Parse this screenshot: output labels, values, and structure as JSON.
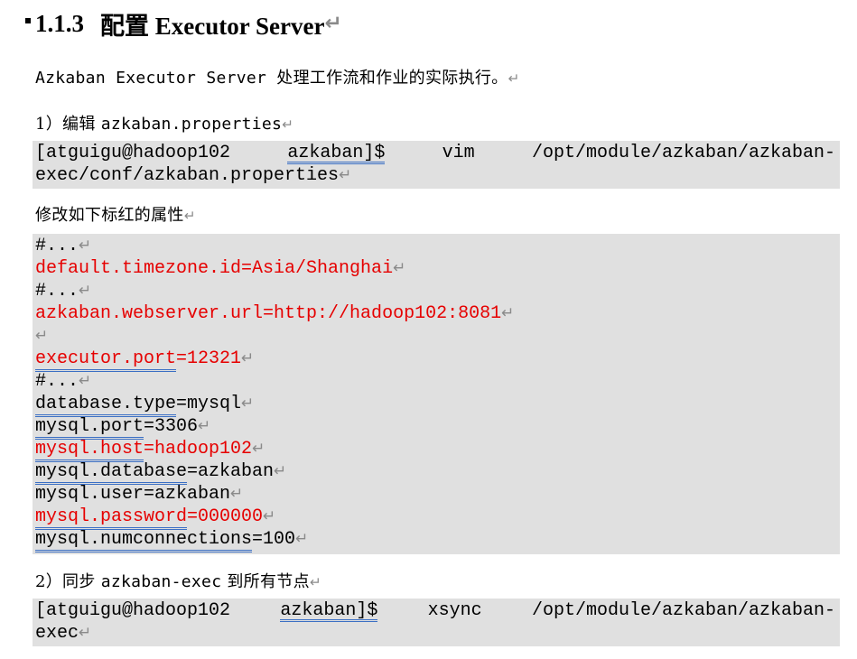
{
  "heading": {
    "number": "1.1.3",
    "title": "配置 Executor Server"
  },
  "intro": "Azkaban Executor Server 处理工作流和作业的实际执行。",
  "step1": {
    "prefix": "1）编辑 ",
    "file": "azkaban.properties"
  },
  "cmd1": {
    "parts": [
      "[atguigu@hadoop102",
      "azkaban]$",
      "vim",
      "/opt/module/azkaban/azkaban-"
    ],
    "line2": "exec/conf/azkaban.properties"
  },
  "modify_note": "修改如下标红的属性",
  "config": {
    "l1": "#...",
    "l2": "default.timezone.id=Asia/Shanghai",
    "l3": "#...",
    "l4": "azkaban.webserver.url=http://hadoop102:8081",
    "l6_key": "executor.port",
    "l6_val": "=12321",
    "l7": "#...",
    "l8_key": "database.type",
    "l8_val": "=mysql",
    "l9_key": "mysql.port",
    "l9_val": "=3306",
    "l10_key": "mysql.host",
    "l10_val": "=hadoop102",
    "l11_key": "mysql.database",
    "l11_val": "=azkaban",
    "l12": "mysql.user=azkaban",
    "l13_key": "mysql.password",
    "l13_val": "=000000",
    "l14_key": "mysql.numconnections",
    "l14_val": "=100"
  },
  "step2": {
    "prefix": "2）同步 ",
    "target": "azkaban-exec",
    "suffix": " 到所有节点"
  },
  "cmd2": {
    "parts": [
      "[atguigu@hadoop102",
      "azkaban]$",
      "xsync",
      "/opt/module/azkaban/azkaban-"
    ],
    "line2": "exec"
  },
  "pilcrow": "↵",
  "colors": {
    "highlight_red": "#e60000",
    "code_background": "#e0e0e0",
    "underline_blue": "#3b6fc4"
  }
}
